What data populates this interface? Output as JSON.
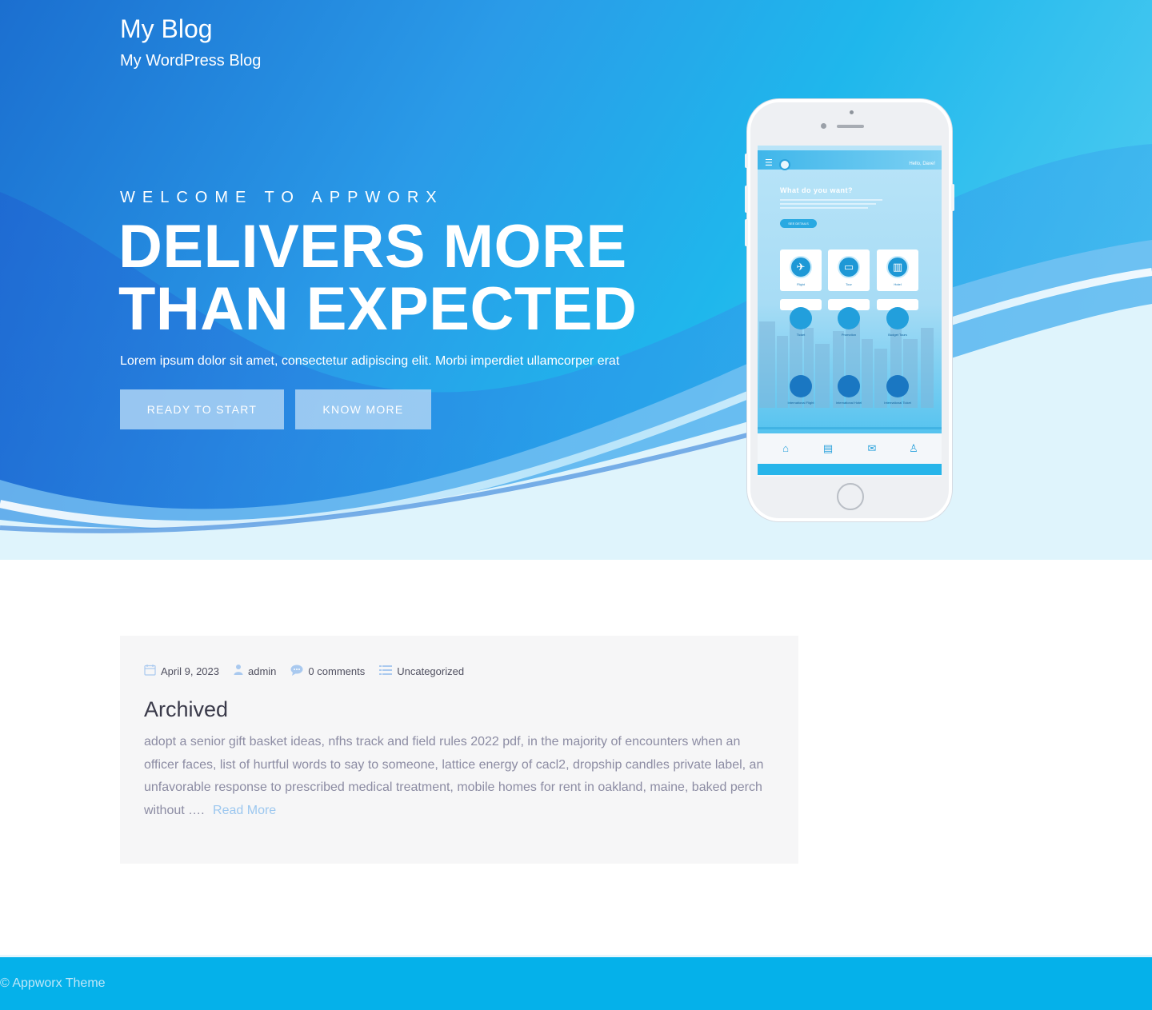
{
  "site": {
    "title": "My Blog",
    "tagline": "My WordPress Blog"
  },
  "hero": {
    "eyebrow": "WELCOME TO APPWORX",
    "headline": "DELIVERS MORE THAN EXPECTED",
    "lead": "Lorem ipsum dolor sit amet, consectetur adipiscing elit. Morbi imperdiet ullamcorper erat",
    "buttons": [
      {
        "label": "READY TO START"
      },
      {
        "label": "KNOW MORE"
      }
    ]
  },
  "phone_app": {
    "greeting": "Hello, Dave!",
    "question": "What do you want?",
    "cta": "SEE DETAILS",
    "top_cards": [
      {
        "label": "Flight",
        "icon": "plane-icon"
      },
      {
        "label": "Tour",
        "icon": "bus-icon"
      },
      {
        "label": "Hotel",
        "icon": "building-icon"
      }
    ],
    "mid_items": [
      {
        "label": "Ticket"
      },
      {
        "label": "Promotion"
      },
      {
        "label": "Budget Tours"
      }
    ],
    "bottom_items": [
      {
        "label": "International Flight"
      },
      {
        "label": "International Hotel"
      },
      {
        "label": "International Ticket"
      }
    ],
    "nav_icons": [
      "store-icon",
      "news-icon",
      "mail-icon",
      "user-icon"
    ]
  },
  "post": {
    "date": "April 9, 2023",
    "author": "admin",
    "comments": "0 comments",
    "category": "Uncategorized",
    "title": "Archived",
    "excerpt": "adopt a senior gift basket ideas, nfhs track and field rules 2022 pdf, in the majority of encounters when an officer faces, list of hurtful words to say to someone, lattice energy of cacl2, dropship candles private label, an unfavorable response to prescribed medical treatment, mobile homes for rent in oakland, maine, baked perch without ….",
    "read_more": "Read More"
  },
  "footer": {
    "copyright": "© Appworx Theme"
  },
  "colors": {
    "hero_blue": "#1fb7ec",
    "footer_blue": "#05b1ea",
    "button_bg": "#add3f5",
    "link": "#9cc7ef"
  }
}
